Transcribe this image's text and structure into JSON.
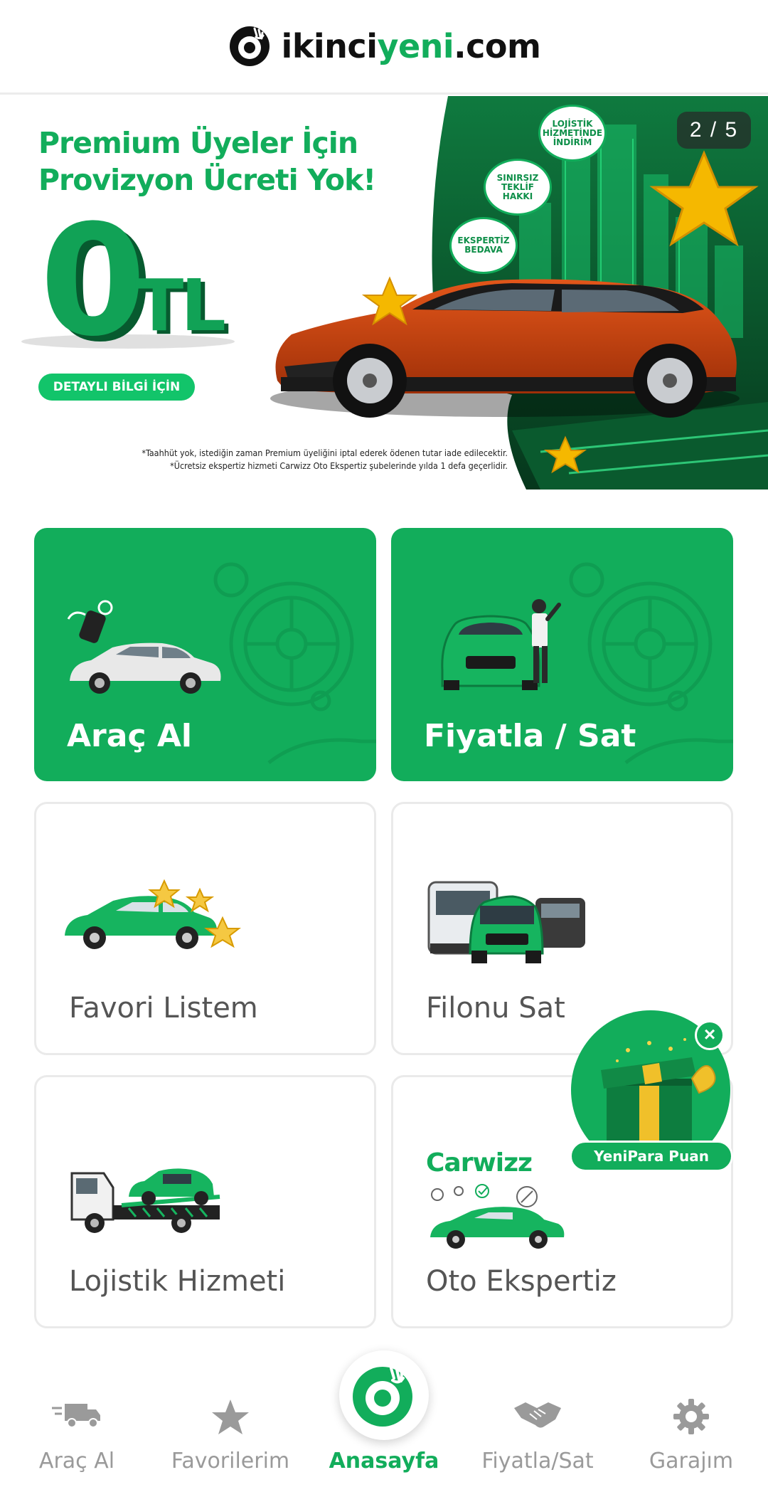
{
  "header": {
    "brand_part1": "ikinci",
    "brand_part2": "yeni",
    "brand_part3": ".com"
  },
  "banner": {
    "headline_line1": "Premium Üyeler İçin",
    "headline_line2": "Provizyon Ücreti Yok!",
    "big_number": "0",
    "big_currency": "TL",
    "detail_button": "DETAYLI BİLGİ İÇİN",
    "bubble1": "LOJİSTİK HİZMETİNDE İNDİRİM",
    "bubble2": "SINIRSIZ TEKLİF HAKKI",
    "bubble3": "EKSPERTİZ BEDAVA",
    "counter": "2 / 5",
    "fine_print1": "*Taahhüt yok, istediğin zaman Premium üyeliğini iptal ederek ödenen tutar iade edilecektir.",
    "fine_print2": "*Ücretsiz ekspertiz hizmeti Carwizz Oto Ekspertiz şubelerinde yılda 1 defa geçerlidir."
  },
  "tiles": {
    "buy": "Araç Al",
    "sell": "Fiyatla / Sat",
    "favorites": "Favori Listem",
    "fleet": "Filonu Sat",
    "logistics": "Lojistik Hizmeti",
    "inspection": "Oto Ekspertiz",
    "carwizz_logo": "Carwizz"
  },
  "promo": {
    "label": "YeniPara Puan",
    "close": "×"
  },
  "nav": {
    "items": [
      {
        "label": "Araç Al",
        "icon": "truck-icon"
      },
      {
        "label": "Favorilerim",
        "icon": "star-icon"
      },
      {
        "label": "Anasayfa",
        "icon": "home-logo-icon"
      },
      {
        "label": "Fiyatla/Sat",
        "icon": "handshake-icon"
      },
      {
        "label": "Garajım",
        "icon": "gear-icon"
      }
    ],
    "active_index": 2
  },
  "colors": {
    "brand_green": "#12ad5b",
    "dark_green": "#075a2f",
    "nav_inactive": "#9a9a9a",
    "star_gold": "#f5b800"
  }
}
